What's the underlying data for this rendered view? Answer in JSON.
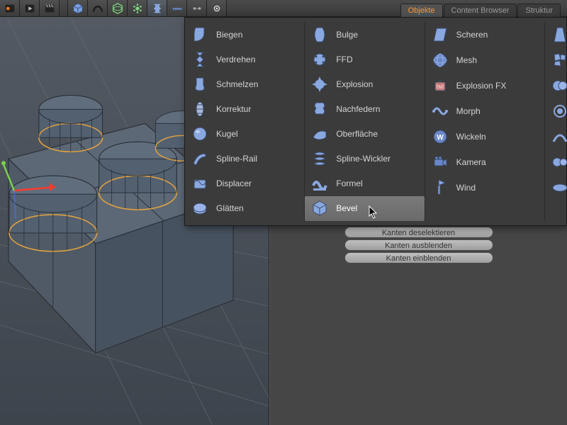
{
  "tabs": {
    "objekte": "Objekte",
    "content_browser": "Content Browser",
    "struktur": "Struktur"
  },
  "buttons": {
    "kanten_deselektieren": "Kanten deselektieren",
    "kanten_ausblenden": "Kanten ausblenden",
    "kanten_einblenden": "Kanten einblenden"
  },
  "deformers": {
    "col1": [
      "Biegen",
      "Verdrehen",
      "Schmelzen",
      "Korrektur",
      "Kugel",
      "Spline-Rail",
      "Displacer",
      "Glätten"
    ],
    "col2": [
      "Bulge",
      "FFD",
      "Explosion",
      "Nachfedern",
      "Oberfläche",
      "Spline-Wickler",
      "Formel",
      "Bevel"
    ],
    "col3": [
      "Scheren",
      "Mesh",
      "Explosion FX",
      "Morph",
      "Wickeln",
      "Kamera",
      "Wind"
    ]
  }
}
